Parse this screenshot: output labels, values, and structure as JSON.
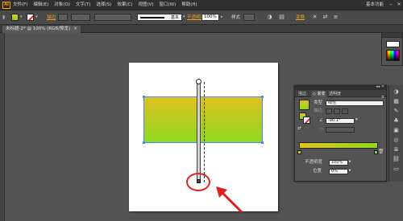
{
  "menubar": {
    "logo": "Ai",
    "items": [
      "文件(F)",
      "编辑(E)",
      "对象(O)",
      "文字(T)",
      "选择(S)",
      "效果(C)",
      "视图(V)",
      "窗口(W)",
      "帮助(H)"
    ],
    "workspace": "基本功能",
    "minimize": "–",
    "close": "✕"
  },
  "control": {
    "stroke_label": "描边",
    "stroke_style": "基本",
    "opacity_label": "不透明度",
    "opacity_value": "100%",
    "style_label": "样式",
    "transform_label": "变换"
  },
  "document": {
    "tab_title": "未标题-2* @ 100% (RGB/预览)",
    "tab_close": "✕"
  },
  "gradient_panel": {
    "tabs": [
      "描边",
      "渐变",
      "透明度"
    ],
    "type_label": "类型",
    "type_value": "线性",
    "stroke_label": "描边",
    "angle_label": "角度",
    "angle_value": "-90.1°",
    "opacity_label": "不透明度",
    "opacity_value": "100%",
    "location_label": "位置",
    "location_value": "0%",
    "colors": {
      "start": "#e2c21d",
      "end": "#8ed920"
    }
  },
  "colors": {
    "highlight": "#e0201c",
    "selection": "#4f86ff",
    "accent_orange": "#f0a020"
  }
}
